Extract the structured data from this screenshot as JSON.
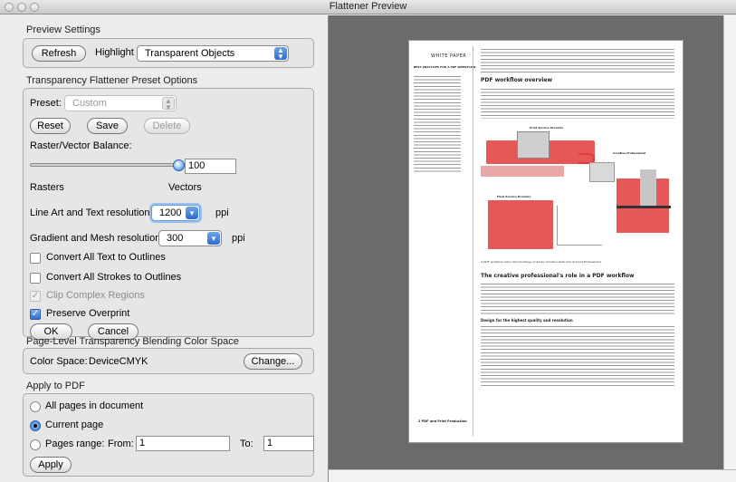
{
  "window": {
    "title": "Flattener Preview"
  },
  "preview_settings": {
    "title": "Preview Settings",
    "refresh_label": "Refresh",
    "highlight_label": "Highlight",
    "highlight_value": "Transparent Objects"
  },
  "preset_options": {
    "title": "Transparency Flattener Preset Options",
    "preset_label": "Preset:",
    "preset_value": "Custom",
    "reset_label": "Reset",
    "save_label": "Save",
    "delete_label": "Delete",
    "balance_label": "Raster/Vector Balance:",
    "balance_value": "100",
    "balance_fraction": 1.0,
    "rasters_label": "Rasters",
    "vectors_label": "Vectors",
    "line_art_label": "Line Art and Text resolution:",
    "line_art_value": "1200",
    "line_art_unit": "ppi",
    "gradient_label": "Gradient and Mesh resolution:",
    "gradient_value": "300",
    "gradient_unit": "ppi",
    "convert_text_label": "Convert All Text to Outlines",
    "convert_strokes_label": "Convert All Strokes to Outlines",
    "clip_label": "Clip Complex Regions",
    "overprint_label": "Preserve Overprint",
    "ok_label": "OK",
    "cancel_label": "Cancel"
  },
  "blending": {
    "title": "Page-Level Transparency Blending Color Space",
    "color_space_label": "Color Space:",
    "color_space_value": "DeviceCMYK",
    "change_label": "Change..."
  },
  "apply": {
    "title": "Apply to PDF",
    "all_pages_label": "All pages in document",
    "current_page_label": "Current page",
    "pages_range_label": "Pages range:",
    "from_label": "From:",
    "from_value": "1",
    "to_label": "To:",
    "to_value": "1",
    "apply_label": "Apply"
  },
  "preview_page": {
    "side_heading": "WHITE PAPER",
    "side_subheading": "BEST PRACTICES FOR A PDF WORKFLOW",
    "section1_heading": "PDF workflow overview",
    "caption": "A PDF workflow takes full advantage of Adobe Creative Suite and Acrobat Professional.",
    "section2_heading": "The creative professional's role in a PDF workflow",
    "subheading": "Design for the highest quality and resolution",
    "footer": "2     PDF and Print Production",
    "step1": "Print Service Provider",
    "step2": "Creative Professional",
    "step3": "Final Service Provider"
  },
  "colors": {
    "accent": "#2d6bd0",
    "highlight_red": "#e23b3b",
    "preview_bg": "#6b6b6b"
  }
}
